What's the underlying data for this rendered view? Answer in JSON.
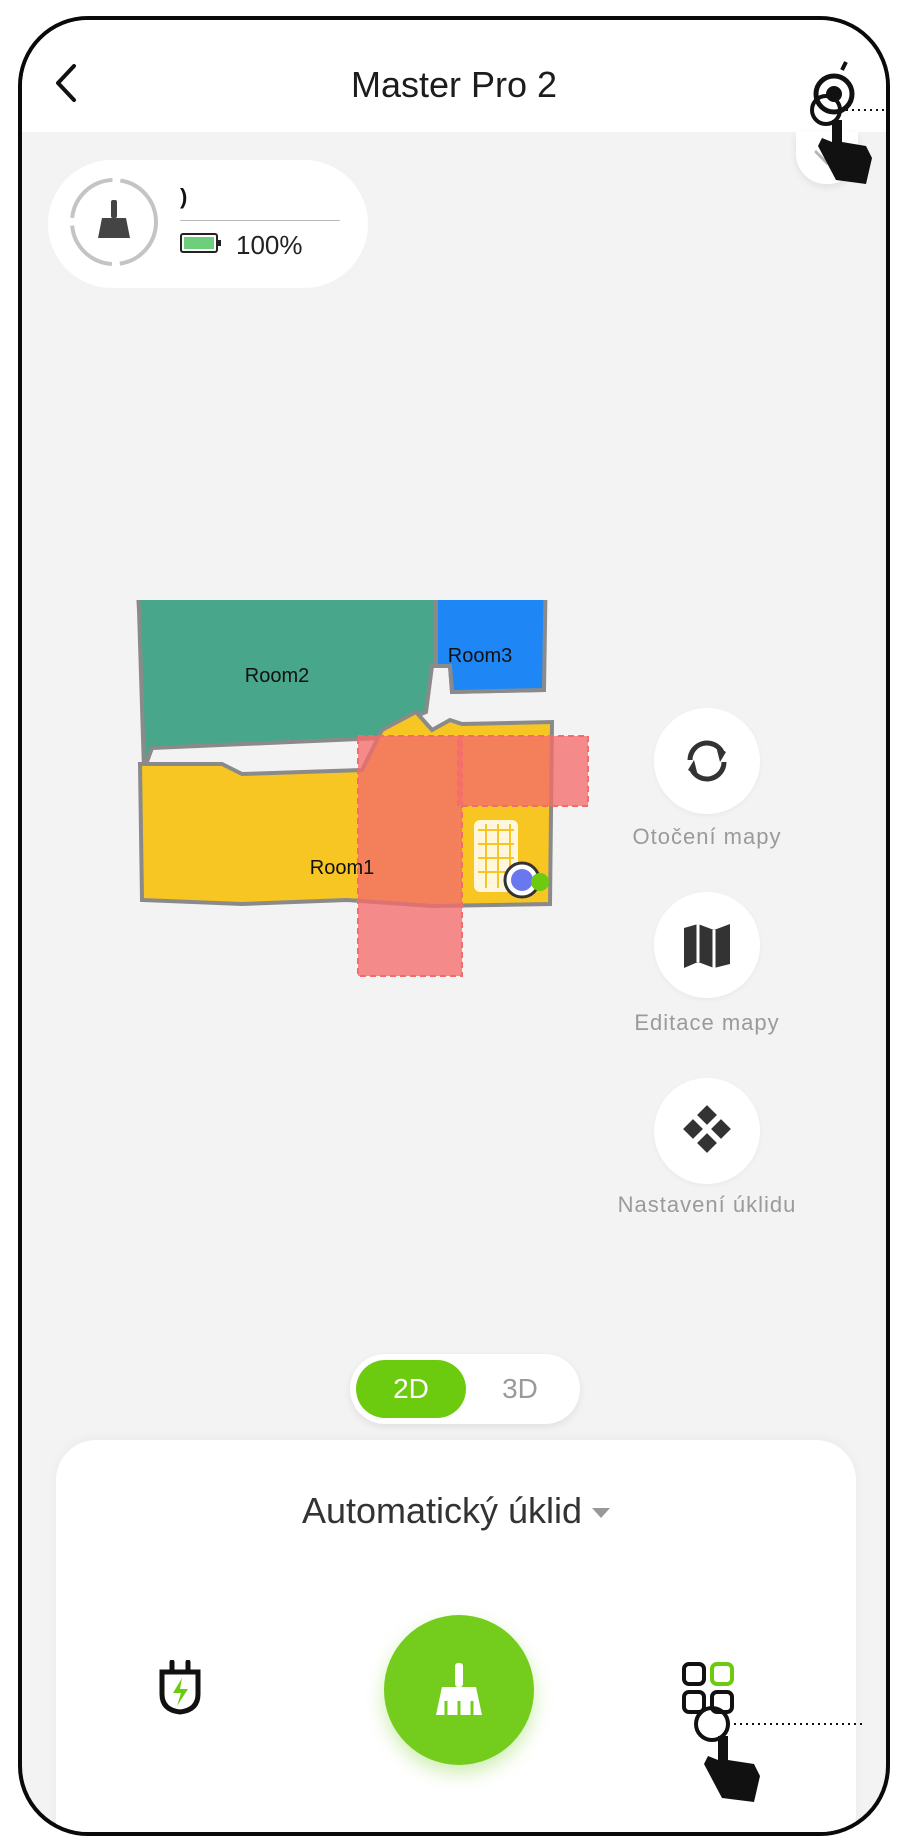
{
  "header": {
    "title": "Master Pro 2"
  },
  "status": {
    "mode": ")",
    "battery": "100%"
  },
  "map": {
    "rooms": [
      "Room2",
      "Room3",
      "Room1"
    ]
  },
  "side_actions": [
    {
      "label": "Otočení mapy",
      "icon": "rotate-icon"
    },
    {
      "label": "Editace mapy",
      "icon": "map-icon"
    },
    {
      "label": "Nastavení úklidu",
      "icon": "clean-settings-icon"
    }
  ],
  "view_toggle": {
    "active": "2D",
    "inactive": "3D"
  },
  "panel": {
    "mode": "Automatický úklid"
  },
  "colors": {
    "accent": "#6cca0f",
    "room1": "#f7c623",
    "room2": "#48a68a",
    "room3": "#1f87f5",
    "zone": "#f36c6c"
  }
}
